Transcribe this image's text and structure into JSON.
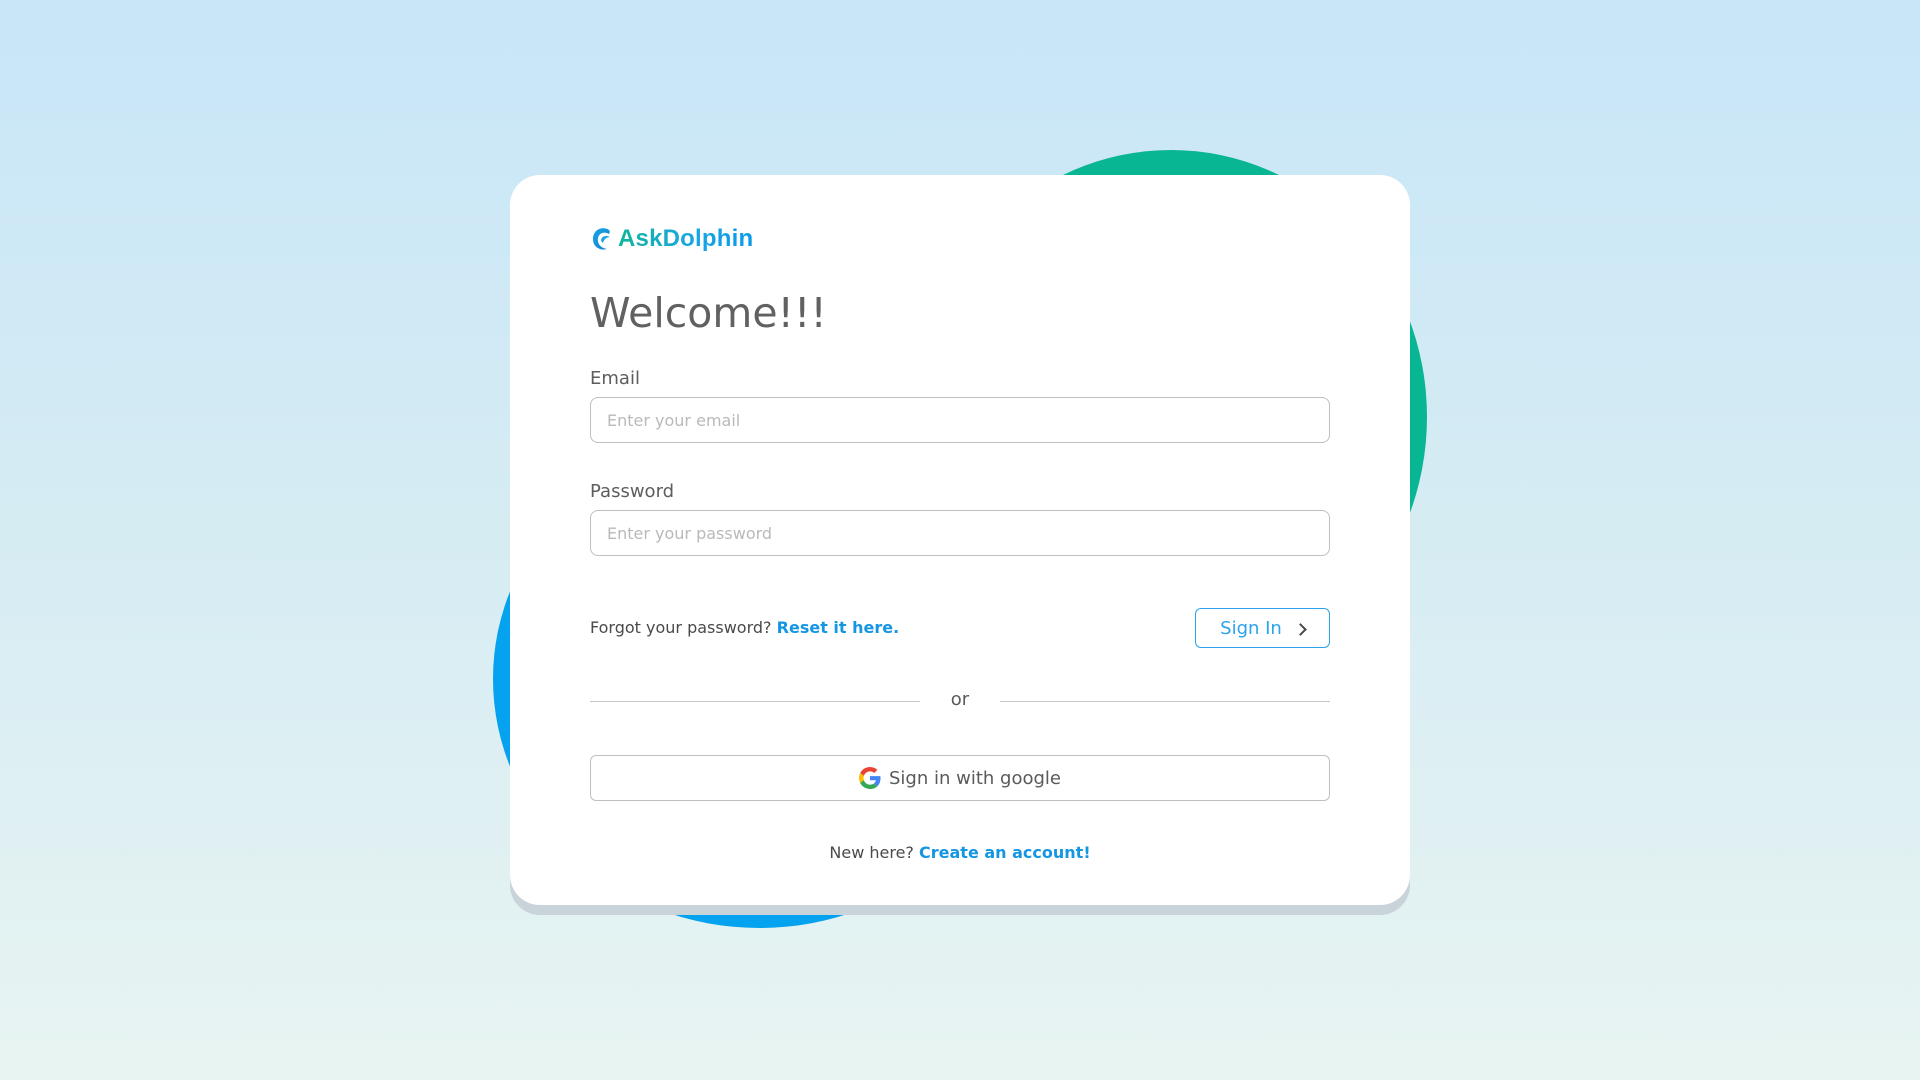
{
  "brand": {
    "name": "AskDolphin",
    "logo_icon": "dolphin-wave-icon",
    "gradient_start": "#10b59a",
    "gradient_end": "#0a9ae8"
  },
  "login": {
    "title": "Welcome!!!",
    "email_label": "Email",
    "email_placeholder": "Enter your email",
    "email_value": "",
    "password_label": "Password",
    "password_placeholder": "Enter your password",
    "password_value": "",
    "forgot_text": "Forgot your password?",
    "reset_link": "Reset it here.",
    "signin_label": "Sign In",
    "divider_text": "or",
    "google_label": "Sign in with google",
    "new_here_text": "New here?",
    "create_account_link": "Create an account!"
  },
  "colors": {
    "accent_blue": "#1596e3",
    "button_blue": "#2aa3eb",
    "blob_green": "#09b694",
    "blob_blue": "#05a2ef"
  },
  "icons": {
    "signin": "chevron-right-icon",
    "google": "google-icon"
  }
}
